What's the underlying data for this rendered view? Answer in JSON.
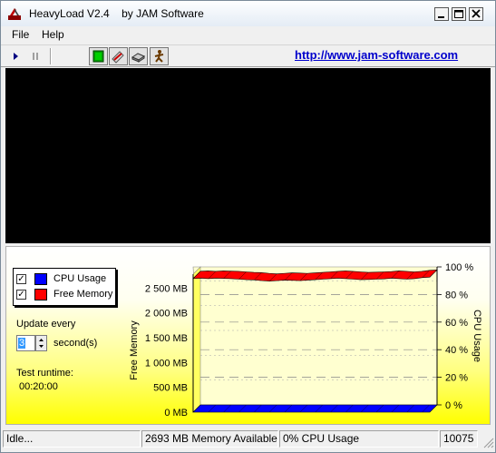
{
  "window": {
    "title": "HeavyLoad V2.4    by JAM Software"
  },
  "menu": {
    "items": [
      {
        "label": "File"
      },
      {
        "label": "Help"
      }
    ]
  },
  "toolbar": {
    "icons": [
      "play-icon",
      "pause-icon",
      "cpu-load-icon",
      "write-disk-icon",
      "allocate-memory-icon",
      "walker-icon"
    ],
    "link_text": "http://www.jam-software.com",
    "link_color": "#0000cc"
  },
  "side_panel": {
    "legend": [
      {
        "label": "CPU Usage",
        "checked": true,
        "color": "#0000ff",
        "check_mark": "✓"
      },
      {
        "label": "Free Memory",
        "checked": true,
        "color": "#ff0000",
        "check_mark": "✓"
      }
    ],
    "update_every_label": "Update every",
    "update_value": "3",
    "update_unit": "second(s)",
    "test_runtime_label": "Test runtime:",
    "test_runtime_value": "00:20:00"
  },
  "chart_data": {
    "type": "area",
    "left_axis": {
      "label": "Free Memory",
      "range": [
        0,
        3000
      ],
      "ticks": [
        "0 MB",
        "500 MB",
        "1 000 MB",
        "1 500 MB",
        "2 000 MB",
        "2 500 MB"
      ]
    },
    "right_axis": {
      "label": "CPU Usage",
      "range": [
        0,
        100
      ],
      "ticks": [
        "0 %",
        "20 %",
        "40 %",
        "60 %",
        "80 %",
        "100 %"
      ]
    },
    "grid": true,
    "legend_placement": "top-left",
    "series": [
      {
        "name": "Free Memory",
        "color": "#ff0000",
        "axis": "left",
        "values": [
          2693,
          2700,
          2690,
          2700,
          2695,
          2690,
          2680,
          2670,
          2665,
          2650,
          2640,
          2650,
          2660,
          2655,
          2650,
          2660,
          2670,
          2680,
          2690,
          2700,
          2690,
          2680,
          2670,
          2675,
          2680,
          2685,
          2700,
          2690,
          2680,
          2690,
          2710,
          2720
        ]
      },
      {
        "name": "CPU Usage",
        "color": "#0000ff",
        "axis": "right",
        "values": [
          0,
          0,
          0,
          0,
          0,
          0,
          0,
          0,
          0,
          0,
          0,
          0,
          0,
          0,
          0,
          0,
          0,
          0,
          0,
          0,
          0,
          0,
          0,
          0,
          0,
          0,
          0,
          0,
          0,
          0,
          0,
          0
        ]
      }
    ]
  },
  "statusbar": {
    "cells": [
      "Idle...",
      "2693 MB Memory Available",
      "0% CPU Usage",
      "10075"
    ]
  }
}
